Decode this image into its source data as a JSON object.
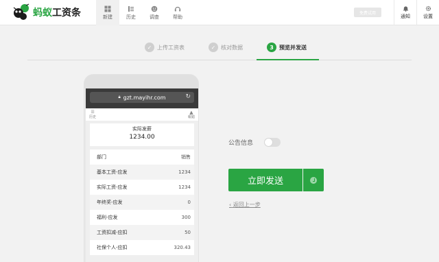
{
  "header": {
    "logo_prefix": "蚂蚁",
    "logo_suffix": "工资条",
    "nav": [
      {
        "label": "新建",
        "icon": "new-icon",
        "active": true
      },
      {
        "label": "历史",
        "icon": "history-icon",
        "active": false
      },
      {
        "label": "调查",
        "icon": "survey-icon",
        "active": false
      },
      {
        "label": "帮助",
        "icon": "help-icon",
        "active": false
      }
    ],
    "trial_label": "免费试用",
    "notify_label": "通知",
    "settings_label": "设置"
  },
  "steps": [
    {
      "label": "上传工资表",
      "mark": "✓",
      "state": "done"
    },
    {
      "label": "核对数据",
      "mark": "✓",
      "state": "done"
    },
    {
      "label": "预览并发送",
      "mark": "3",
      "state": "active"
    }
  ],
  "phone": {
    "url": "gzt.mayihr.com",
    "left_label": "历史",
    "right_label": "報錯",
    "salary_label": "实际发薪",
    "salary_value": "1234.00",
    "table_header": {
      "name": "部门",
      "value": "销售"
    },
    "rows": [
      {
        "name": "基本工资-应发",
        "value": "1234"
      },
      {
        "name": "实际工资-应发",
        "value": "1234"
      },
      {
        "name": "年终奖-应发",
        "value": "0"
      },
      {
        "name": "福利-应发",
        "value": "300"
      },
      {
        "name": "工资扣减-应扣",
        "value": "50"
      },
      {
        "name": "社保个人-应扣",
        "value": "320.43"
      }
    ]
  },
  "panel": {
    "notice_label": "公告信息",
    "notice_enabled": false,
    "send_label": "立即发送",
    "back_label": "返回上一步"
  },
  "colors": {
    "accent": "#2aa543",
    "header_bg": "#ffffff",
    "page_bg": "#f2f2f2"
  }
}
